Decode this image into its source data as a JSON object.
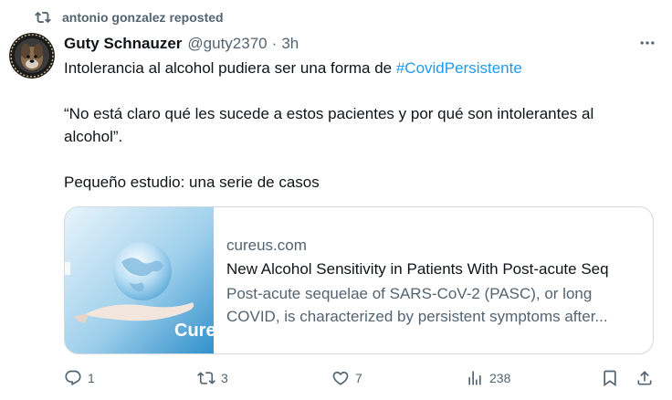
{
  "repost": {
    "text": "antonio gonzalez reposted",
    "icon": "repost-icon"
  },
  "author": {
    "name": "Guty Schnauzer",
    "handle": "@guty2370",
    "separator": "·",
    "time": "3h",
    "avatar_icon": "dog-avatar"
  },
  "post": {
    "line1_prefix": "Intolerancia al alcohol pudiera ser una forma de ",
    "hashtag": "#CovidPersistente",
    "quote": "“No está claro qué les sucede a estos pacientes y por qué son intolerantes al alcohol”.",
    "line3": "Pequeño estudio: una serie de casos"
  },
  "card": {
    "domain": "cureus.com",
    "title": "New Alcohol Sensitivity in Patients With Post-acute Seq",
    "description": "Post-acute sequelae of SARS-CoV-2 (PASC), or long COVID, is characterized by persistent symptoms after...",
    "image_label": "Cure"
  },
  "actions": {
    "replies": "1",
    "reposts": "3",
    "likes": "7",
    "views": "238"
  },
  "colors": {
    "accent": "#1d9bf0",
    "muted": "#536471",
    "border": "#cfd9de"
  }
}
